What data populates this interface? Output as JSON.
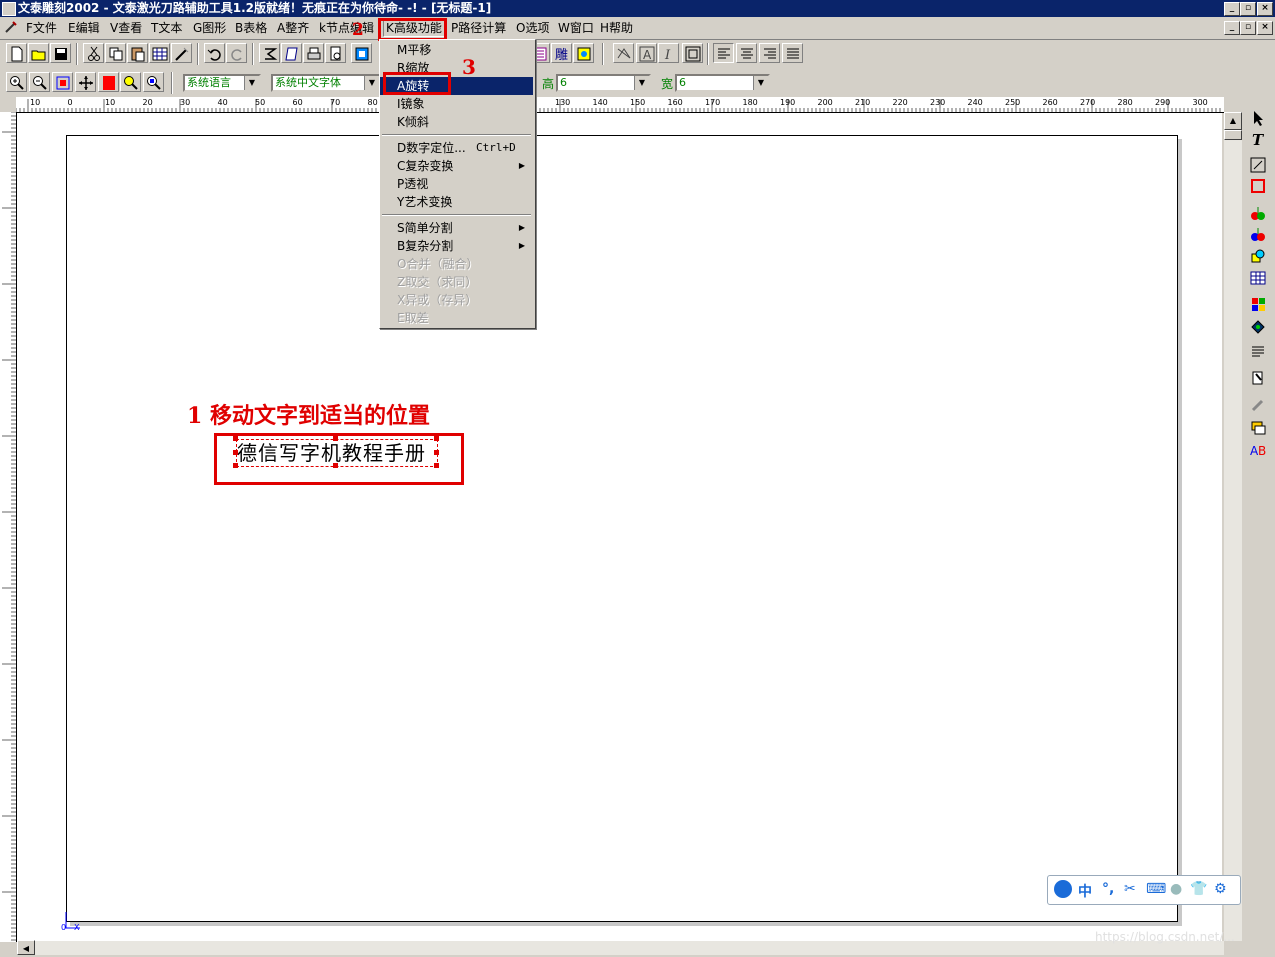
{
  "window": {
    "title": "文泰雕刻2002 - 文泰激光刀路辅助工具1.2版就绪！无痕正在为你待命- -! - [无标题-1]"
  },
  "menubar": {
    "items": [
      "F文件",
      "E编辑",
      "V查看",
      "T文本",
      "G图形",
      "B表格",
      "A整齐",
      "k节点编辑",
      "K高级功能",
      "P路径计算",
      "O选项",
      "W窗口",
      "H帮助"
    ]
  },
  "toolbar2": {
    "language_combo": "系统语言",
    "font_combo": "系统中文字体",
    "height_label": "高",
    "height_value": "6",
    "width_label": "宽",
    "width_value": "6"
  },
  "advanced_menu": {
    "items": [
      {
        "label": "M平移",
        "enabled": true
      },
      {
        "label": "R缩放",
        "enabled": true
      },
      {
        "label": "A旋转",
        "enabled": true,
        "selected": true
      },
      {
        "label": "I镜象",
        "enabled": true
      },
      {
        "label": "K倾斜",
        "enabled": true
      },
      {
        "label": "D数字定位...",
        "shortcut": "Ctrl+D",
        "enabled": true
      },
      {
        "label": "C复杂变换",
        "submenu": true,
        "enabled": true
      },
      {
        "label": "P透视",
        "enabled": true
      },
      {
        "label": "Y艺术变换",
        "enabled": true
      },
      {
        "label": "S简单分割",
        "submenu": true,
        "enabled": true
      },
      {
        "label": "B复杂分割",
        "submenu": true,
        "enabled": true
      },
      {
        "label": "O合并（融合）",
        "enabled": false
      },
      {
        "label": "Z取交（求同）",
        "enabled": false
      },
      {
        "label": "X异或（存异）",
        "enabled": false
      },
      {
        "label": "E取差",
        "enabled": false
      }
    ]
  },
  "annotations": {
    "step1": "1  移动文字到适当的位置",
    "step2": "2",
    "step3": "3"
  },
  "canvas": {
    "sample_text": "德信写字机教程手册"
  },
  "ruler": {
    "h_labels": [
      "10",
      "0",
      "10",
      "20",
      "30",
      "40",
      "50",
      "60",
      "70",
      "80",
      "90",
      "100",
      "110",
      "120",
      "130",
      "140",
      "150",
      "160",
      "170",
      "180",
      "190",
      "200",
      "210",
      "220",
      "230",
      "240",
      "250",
      "260",
      "270",
      "280",
      "290",
      "300",
      "310"
    ]
  },
  "ime": {
    "lang": "中"
  },
  "watermark": "https://blog.csdn.net/..."
}
